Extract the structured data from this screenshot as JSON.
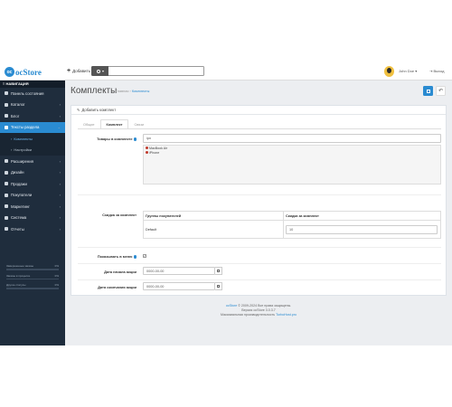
{
  "header": {
    "logo_text": "ocStore",
    "add_label": "Добавить",
    "user_name": "John Doe",
    "user_caret": "▾",
    "logout_label": "Выход"
  },
  "sidebar": {
    "title": "НАВИГАЦИЯ",
    "items": [
      {
        "label": "Панель состояния",
        "icon": "dashboard-icon"
      },
      {
        "label": "Каталог",
        "icon": "tag-icon",
        "arrow": true
      },
      {
        "label": "Блог",
        "icon": "book-icon",
        "arrow": true
      },
      {
        "label": "Тексты раздела",
        "icon": "file-icon",
        "arrow": true,
        "active": true
      }
    ],
    "subitems": [
      {
        "label": "Комплекты",
        "active": true
      },
      {
        "label": "Настройки",
        "active": false
      }
    ],
    "items_after": [
      {
        "label": "Расширения",
        "icon": "puzzle-icon",
        "arrow": true
      },
      {
        "label": "Дизайн",
        "icon": "desktop-icon",
        "arrow": true
      },
      {
        "label": "Продажи",
        "icon": "cart-icon",
        "arrow": true
      },
      {
        "label": "Покупатели",
        "icon": "user-icon",
        "arrow": true
      },
      {
        "label": "Маркетинг",
        "icon": "share-icon",
        "arrow": true
      },
      {
        "label": "Система",
        "icon": "gear-icon",
        "arrow": true
      },
      {
        "label": "Отчеты",
        "icon": "bar-chart-icon",
        "arrow": true
      }
    ],
    "stats": [
      {
        "label": "Завершенные заказы",
        "value": "0%"
      },
      {
        "label": "Заказы в процессе",
        "value": "0%"
      },
      {
        "label": "Другие статусы",
        "value": "0%"
      }
    ]
  },
  "content": {
    "page_title": "Комплекты",
    "breadcrumb": [
      "Главная",
      "Комплекты"
    ],
    "panel_title": "Добавить комплект",
    "tabs": [
      {
        "label": "Общие",
        "active": false
      },
      {
        "label": "Комплект",
        "active": true
      },
      {
        "label": "Связи",
        "active": false
      }
    ],
    "products_label": "Товары в комплекте",
    "products_input": "ipn",
    "products": [
      "MacBook Air",
      "iPhone"
    ],
    "discount_label": "Скидка за комплект",
    "discount_table": {
      "headers": [
        "Группы покупателей",
        "Скидка за комплект"
      ],
      "row": {
        "group": "Default",
        "discount": "10"
      }
    },
    "show_in_list_label": "Показывать в меню",
    "show_in_list_checked": "✓",
    "start_date_label": "Дата начала акции",
    "start_date_value": "0000-00-00",
    "end_date_label": "Дата окончания акции",
    "end_date_value": "0000-00-00",
    "footer": {
      "line1_brand": "ocStore",
      "line1_rest": " © 2009-2024 Все права защищены.",
      "line2": "Версия ocStore 3.0.3.7",
      "line3_text": "Максимальная производительность ",
      "line3_link": "TurboHost.pro"
    }
  },
  "colors": {
    "accent": "#2a8bd1",
    "sidebar_bg": "#1f2d3d",
    "content_bg": "#eceef1"
  }
}
